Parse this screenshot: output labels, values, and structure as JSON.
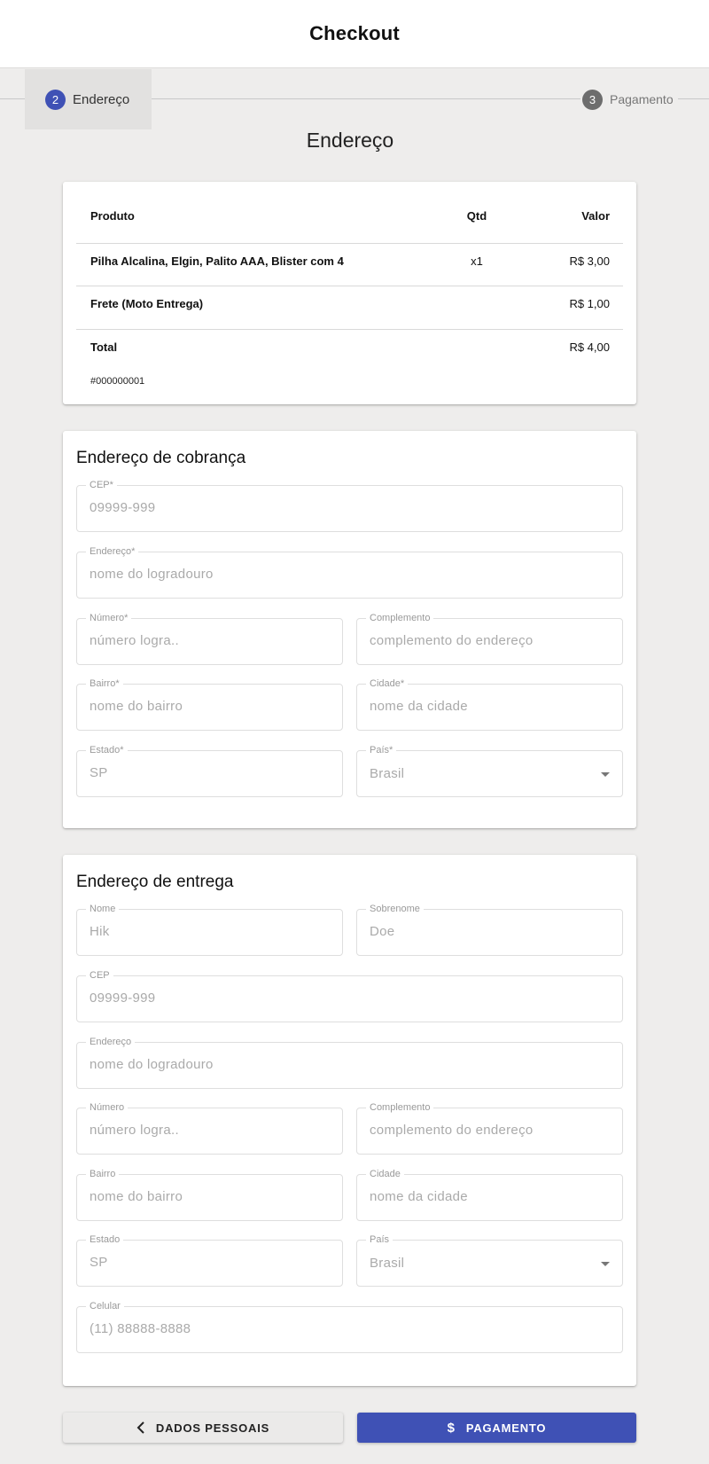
{
  "header": {
    "title": "Checkout"
  },
  "stepper": {
    "steps": [
      {
        "number": "2",
        "label": "Endereço",
        "active": true
      },
      {
        "number": "3",
        "label": "Pagamento",
        "active": false
      }
    ]
  },
  "page_title": "Endereço",
  "summary": {
    "headers": {
      "product": "Produto",
      "qty": "Qtd",
      "value": "Valor"
    },
    "item": {
      "product": "Pilha Alcalina, Elgin, Palito AAA, Blister com 4",
      "qty": "x1",
      "value": "R$ 3,00"
    },
    "shipping": {
      "label": "Frete (Moto Entrega)",
      "value": "R$ 1,00"
    },
    "total": {
      "label": "Total",
      "value": "R$ 4,00"
    },
    "order_id": "#000000001"
  },
  "billing": {
    "title": "Endereço de cobrança",
    "cep": {
      "label": "CEP*",
      "placeholder": "09999-999"
    },
    "endereco": {
      "label": "Endereço*",
      "placeholder": "nome do logradouro"
    },
    "numero": {
      "label": "Número*",
      "placeholder": "número logra.."
    },
    "complemento": {
      "label": "Complemento",
      "placeholder": "complemento do endereço"
    },
    "bairro": {
      "label": "Bairro*",
      "placeholder": "nome do bairro"
    },
    "cidade": {
      "label": "Cidade*",
      "placeholder": "nome da cidade"
    },
    "estado": {
      "label": "Estado*",
      "placeholder": "SP"
    },
    "pais": {
      "label": "País*",
      "value": "Brasil"
    }
  },
  "shipping_address": {
    "title": "Endereço de entrega",
    "nome": {
      "label": "Nome",
      "placeholder": "Hik"
    },
    "sobrenome": {
      "label": "Sobrenome",
      "placeholder": "Doe"
    },
    "cep": {
      "label": "CEP",
      "placeholder": "09999-999"
    },
    "endereco": {
      "label": "Endereço",
      "placeholder": "nome do logradouro"
    },
    "numero": {
      "label": "Número",
      "placeholder": "número logra.."
    },
    "complemento": {
      "label": "Complemento",
      "placeholder": "complemento do endereço"
    },
    "bairro": {
      "label": "Bairro",
      "placeholder": "nome do bairro"
    },
    "cidade": {
      "label": "Cidade",
      "placeholder": "nome da cidade"
    },
    "estado": {
      "label": "Estado",
      "placeholder": "SP"
    },
    "pais": {
      "label": "País",
      "value": "Brasil"
    },
    "celular": {
      "label": "Celular",
      "placeholder": "(11) 88888-8888"
    }
  },
  "actions": {
    "back_label": "DADOS PESSOAIS",
    "next_label": "PAGAMENTO"
  },
  "colors": {
    "primary": "#3f51b5",
    "background": "#eeedec",
    "step_inactive": "#6d6d6d"
  }
}
